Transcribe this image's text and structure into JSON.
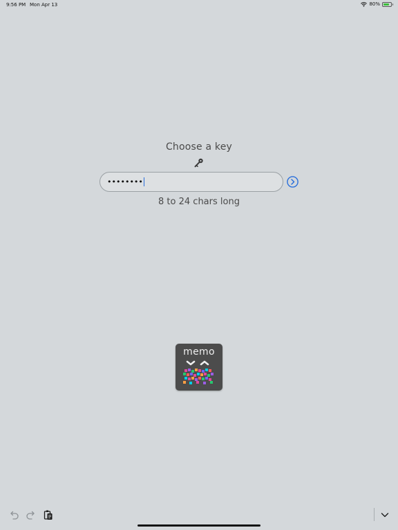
{
  "status_bar": {
    "time": "9:56 PM",
    "date": "Mon Apr 13",
    "battery_percent": "80%",
    "battery_level": 0.8,
    "wifi_icon": "wifi-icon",
    "battery_icon": "battery-charging-icon"
  },
  "key_screen": {
    "title": "Choose a key",
    "key_icon": "key-icon",
    "password_value": "••••••••",
    "submit_icon": "arrow-right-circle-icon",
    "hint": "8 to 24 chars long"
  },
  "logo": {
    "text": "memo",
    "background_color": "#4c4c4c"
  },
  "toolbar": {
    "undo_icon": "undo-icon",
    "redo_icon": "redo-icon",
    "paste_icon": "paste-icon",
    "dismiss_icon": "chevron-down-icon"
  },
  "colors": {
    "background": "#d4d8db",
    "accent": "#2a6fdb",
    "battery_fill": "#3bbf3b"
  }
}
